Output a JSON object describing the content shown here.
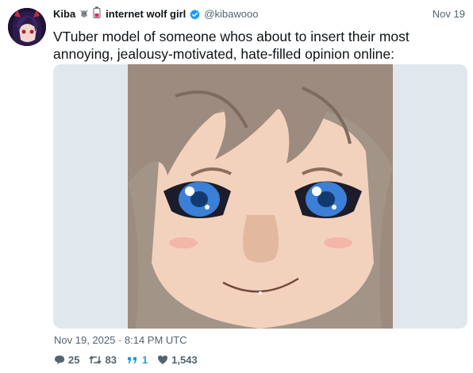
{
  "user": {
    "display_name": "Kiba",
    "bio_name": "internet wolf girl",
    "handle": "@kibawooo",
    "date": "Nov 19"
  },
  "tweet": {
    "text": "VTuber model of someone whos about to insert their most annoying, jealousy-motivated, hate-filled opinion online:",
    "timestamp": "Nov 19, 2025 · 8:14 PM UTC"
  },
  "stats": {
    "replies": "25",
    "retweets": "83",
    "quotes": "1",
    "likes": "1,543"
  },
  "icons": {
    "verified": "verified-badge-icon",
    "wolf": "wolf-icon",
    "battery": "battery-icon"
  },
  "colors": {
    "accent": "#1d9bf0",
    "muted": "#536471",
    "media_bg": "#e1e8ed"
  }
}
